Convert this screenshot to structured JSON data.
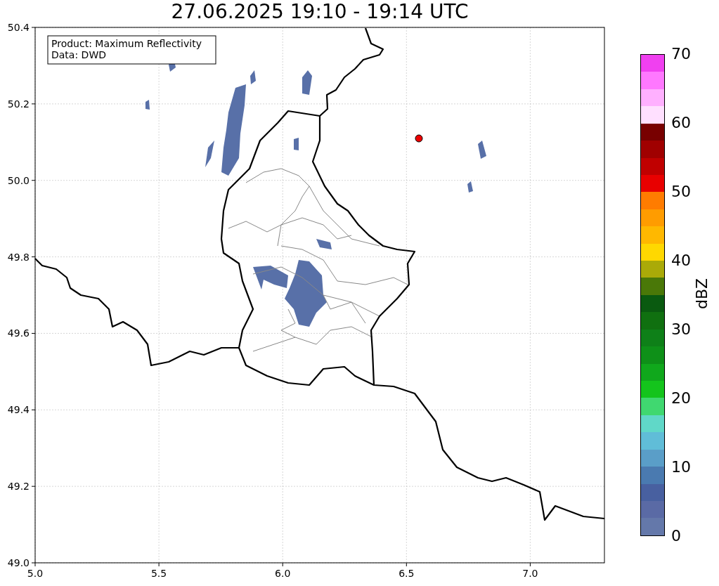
{
  "title": "27.06.2025 19:10 - 19:14 UTC",
  "map": {
    "legend_lines": [
      "Product: Maximum Reflectivity",
      "Data: DWD"
    ],
    "xticks": [
      "5.0",
      "5.5",
      "6.0",
      "6.5",
      "7.0"
    ],
    "yticks": [
      "50.4",
      "50.2",
      "50.0",
      "49.8",
      "49.6",
      "49.4",
      "49.2",
      "49.0"
    ]
  },
  "colorbar": {
    "label": "dBZ",
    "ticks": [
      "70",
      "60",
      "50",
      "40",
      "30",
      "20",
      "10",
      "0"
    ],
    "bands": [
      {
        "color": "#f040f0"
      },
      {
        "color": "#ff78ff"
      },
      {
        "color": "#ffb0ff"
      },
      {
        "color": "#ffe0ff"
      },
      {
        "color": "#780000"
      },
      {
        "color": "#a00000"
      },
      {
        "color": "#c00000"
      },
      {
        "color": "#e80000"
      },
      {
        "color": "#ff7c00"
      },
      {
        "color": "#ff9c00"
      },
      {
        "color": "#ffb800"
      },
      {
        "color": "#ffd800"
      },
      {
        "color": "#aaaa08"
      },
      {
        "color": "#4a7808"
      },
      {
        "color": "#0a5a10"
      },
      {
        "color": "#107010"
      },
      {
        "color": "#0e8018"
      },
      {
        "color": "#0e9018"
      },
      {
        "color": "#10a81c"
      },
      {
        "color": "#14c41c"
      },
      {
        "color": "#40d870"
      },
      {
        "color": "#60d8c8"
      },
      {
        "color": "#60bdd8"
      },
      {
        "color": "#5a9ec8"
      },
      {
        "color": "#4a7ab0"
      },
      {
        "color": "#4860a0"
      },
      {
        "color": "#5a6aa5"
      },
      {
        "color": "#6478aa"
      }
    ]
  }
}
